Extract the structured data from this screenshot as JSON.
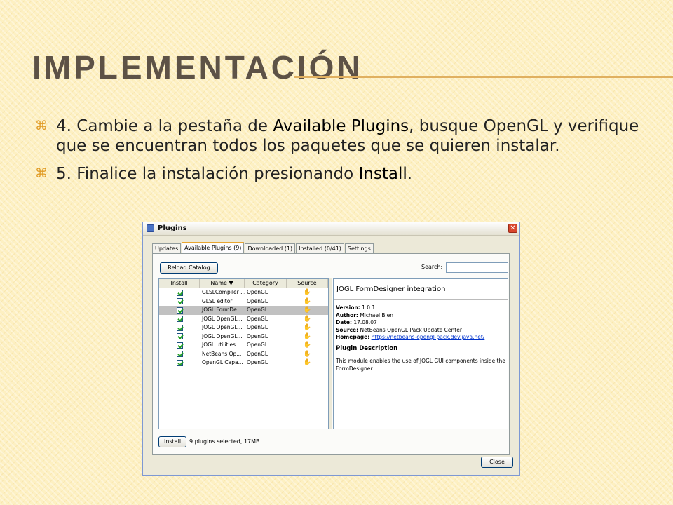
{
  "slide": {
    "title": "IMPLEMENTACIÓN",
    "bullet_mark": "⌘",
    "bullets": [
      {
        "text_a": "4. Cambie a la pestaña de ",
        "emph": "Available Plugins",
        "text_b": ", busque OpenGL y verifique que se encuentran todos los paquetes que se quieren instalar."
      },
      {
        "text_a": "5. Finalice la instalación presionando ",
        "emph": "Install",
        "text_b": "."
      }
    ]
  },
  "window": {
    "title": "Plugins",
    "close_glyph": "✕",
    "tabs": [
      "Updates",
      "Available Plugins (9)",
      "Downloaded (1)",
      "Installed (0/41)",
      "Settings"
    ],
    "active_tab": "Available Plugins (9)",
    "reload_label": "Reload Catalog",
    "search_label": "Search:",
    "search_value": "",
    "columns": [
      "Install",
      "Name ▼",
      "Category",
      "Source"
    ],
    "rows": [
      {
        "name": "GLSLCompiler ...",
        "category": "OpenGL",
        "selected": false
      },
      {
        "name": "GLSL editor",
        "category": "OpenGL",
        "selected": false
      },
      {
        "name": "JOGL FormDe...",
        "category": "OpenGL",
        "selected": true
      },
      {
        "name": "JOGL OpenGL...",
        "category": "OpenGL",
        "selected": false
      },
      {
        "name": "JOGL OpenGL...",
        "category": "OpenGL",
        "selected": false
      },
      {
        "name": "JOGL OpenGL...",
        "category": "OpenGL",
        "selected": false
      },
      {
        "name": "JOGL utilities",
        "category": "OpenGL",
        "selected": false
      },
      {
        "name": "NetBeans Op...",
        "category": "OpenGL",
        "selected": false
      },
      {
        "name": "OpenGL Capa...",
        "category": "OpenGL",
        "selected": false
      }
    ],
    "source_glyph": "✋",
    "detail": {
      "title": "JOGL FormDesigner integration",
      "version_k": "Version:",
      "version": "1.0.1",
      "author_k": "Author:",
      "author": "Michael Bien",
      "date_k": "Date:",
      "date": "17.08.07",
      "source_k": "Source:",
      "source": "NetBeans OpenGL Pack Update Center",
      "homepage_k": "Homepage:",
      "homepage": "https://netbeans-opengl-pack.dev.java.net/",
      "desc_heading": "Plugin Description",
      "desc": "This module enables the use of JOGL GUI components inside the FormDesigner."
    },
    "install_label": "Install",
    "status": "9 plugins selected, 17MB",
    "close_label": "Close"
  }
}
